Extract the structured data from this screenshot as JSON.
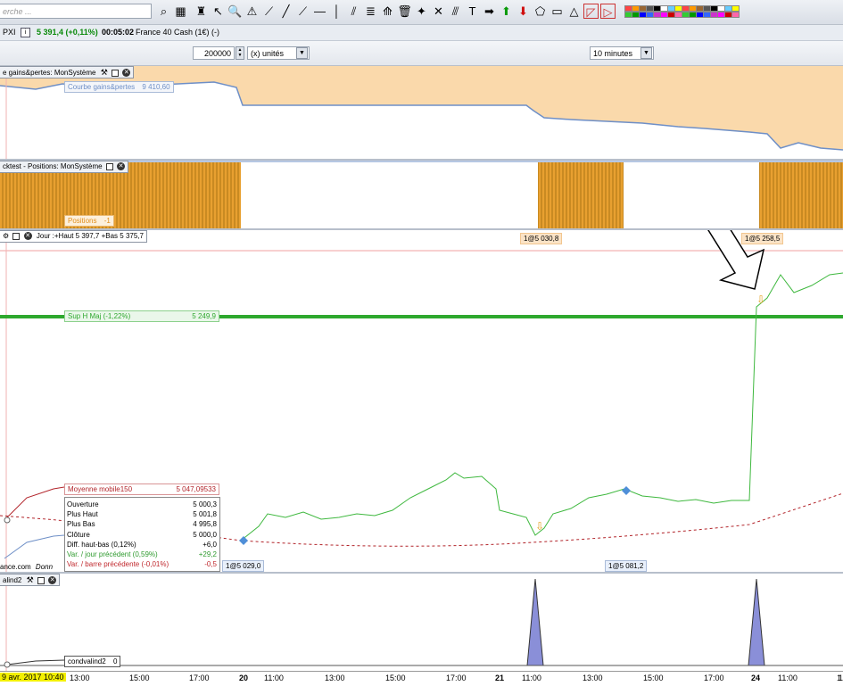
{
  "toolbar": {
    "search_placeholder": "erche ...",
    "icons": [
      "search-icon",
      "calendar-icon",
      "person-icon",
      "cursor-icon",
      "zoom-icon",
      "alert-icon",
      "ruler-icon",
      "line-icon",
      "trend-icon",
      "hline-icon",
      "vline-icon",
      "channel-icon",
      "text-icon",
      "fan-icon",
      "delete-icon",
      "magic-icon",
      "cross-icon",
      "lines-icon",
      "box-icon",
      "arrow-right-icon",
      "arrow-up-icon",
      "arrow-down-icon",
      "shape-icon",
      "rect-icon",
      "triangle-icon",
      "indicator-icon",
      "highlight-icon"
    ],
    "palette": [
      "#ff4444",
      "#ff9900",
      "#996633",
      "#555555",
      "#000000",
      "#ffffff",
      "#66ccff",
      "#ffff00",
      "#33cc33",
      "#009900",
      "#0000ff",
      "#3366ff",
      "#cc33cc",
      "#ff00ff",
      "#cc0000",
      "#ff66aa"
    ]
  },
  "infobar": {
    "symbol": "PXI",
    "price": "5 391,4 (+0,11%)",
    "time": "00:05:02",
    "instrument": "France 40 Cash (1€) (-)"
  },
  "controls": {
    "quantity": "200000",
    "unit": "(x) unités",
    "timeframe": "10 minutes"
  },
  "panel_equity": {
    "title": "e gains&pertes: MonSystème",
    "label": "Courbe gains&pertes",
    "value": "9 410,60"
  },
  "panel_positions": {
    "title": "cktest - Positions: MonSystème",
    "label": "Positions",
    "value": "-1"
  },
  "panel_price": {
    "title": "Jour :+Haut 5 397,7 +Bas 5 375,7",
    "trade_tags": [
      "1@5 030,8",
      "1@5 258,5",
      "1@5 029,0",
      "1@5 081,2"
    ],
    "sup_label": "Sup H Maj (-1,22%)",
    "sup_value": "5 249,9",
    "ma_label": "Moyenne mobile150",
    "ma_value": "5 047,09533",
    "source": "ance.com",
    "source_suffix": "Donn",
    "ohlc": [
      {
        "label": "Ouverture",
        "value": "5 000,3",
        "color": "#000000"
      },
      {
        "label": "Plus Haut",
        "value": "5 001,8",
        "color": "#000000"
      },
      {
        "label": "Plus Bas",
        "value": "4 995,8",
        "color": "#000000"
      },
      {
        "label": "Clôture",
        "value": "5 000,0",
        "color": "#000000"
      },
      {
        "label": "Diff. haut-bas (0,12%)",
        "value": "+6,0",
        "color": "#000000"
      },
      {
        "label": "Var. / jour précédent (0,59%)",
        "value": "+29,2",
        "color": "#2e9a2e"
      },
      {
        "label": "Var. / barre précédente (-0,01%)",
        "value": "-0,5",
        "color": "#c0282d"
      }
    ]
  },
  "panel_cond": {
    "title": "alind2",
    "label": "condvalind2",
    "value": "0"
  },
  "xaxis": {
    "current_date": "9 avr. 2017 10:40",
    "ticks": [
      {
        "t": "13:00",
        "b": false
      },
      {
        "t": "15:00",
        "b": false
      },
      {
        "t": "17:00",
        "b": false
      },
      {
        "t": "20",
        "b": true
      },
      {
        "t": "11:00",
        "b": false
      },
      {
        "t": "13:00",
        "b": false
      },
      {
        "t": "15:00",
        "b": false
      },
      {
        "t": "17:00",
        "b": false
      },
      {
        "t": "21",
        "b": true
      },
      {
        "t": "11:00",
        "b": false
      },
      {
        "t": "13:00",
        "b": false
      },
      {
        "t": "15:00",
        "b": false
      },
      {
        "t": "17:00",
        "b": false
      },
      {
        "t": "24",
        "b": true
      },
      {
        "t": "11:00",
        "b": false
      },
      {
        "t": "13:00",
        "b": false
      },
      {
        "t": "1",
        "b": false
      }
    ]
  }
}
